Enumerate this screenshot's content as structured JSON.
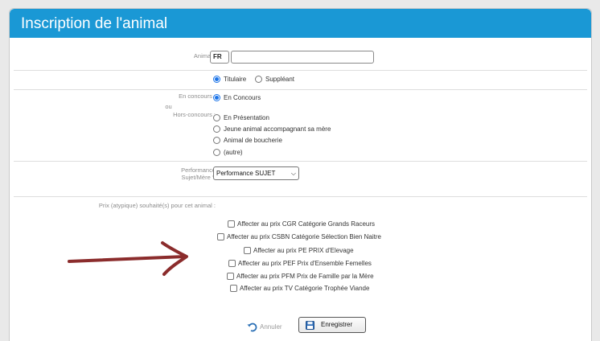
{
  "header": {
    "title": "Inscription de l'animal"
  },
  "animal": {
    "label": "Animal :",
    "country_value": "FR",
    "number_value": ""
  },
  "holder": {
    "options": [
      "Titulaire",
      "Suppléant"
    ],
    "selected": "Titulaire"
  },
  "competition": {
    "label_en_concours": "En concours :",
    "label_ou": "ou",
    "label_hors_concours": "Hors-concours :",
    "options": [
      "En Concours",
      "En Présentation",
      "Jeune animal accompagnant sa mère",
      "Animal de boucherie",
      "(autre)"
    ],
    "selected": "En Concours"
  },
  "performance": {
    "label_line1": "Performance",
    "label_line2": "Sujet/Mère ?",
    "selected_value": "Performance SUJET"
  },
  "prizes": {
    "label": "Prix (atypique) souhaité(s) pour cet animal :",
    "items": [
      "Affecter au prix CGR Catégorie Grands Raceurs",
      "Affecter au prix CSBN Catégorie Sélection Bien Naitre",
      "Affecter au prix PE PRIX d'Elevage",
      "Affecter au prix PEF Prix d'Ensemble Femelles",
      "Affecter au prix PFM Prix de Famille par la Mère",
      "Affecter au prix TV Catégorie Trophée Viande"
    ]
  },
  "actions": {
    "cancel_label": "Annuler",
    "save_label": "Enregistrer"
  },
  "colors": {
    "header_bg": "#1a98d5",
    "arrow": "#8b2c2c",
    "radio_accent": "#1a73e8"
  },
  "icons": {
    "cancel": "undo-icon",
    "save": "floppy-disk-icon",
    "annotation": "hand-drawn-arrow"
  }
}
